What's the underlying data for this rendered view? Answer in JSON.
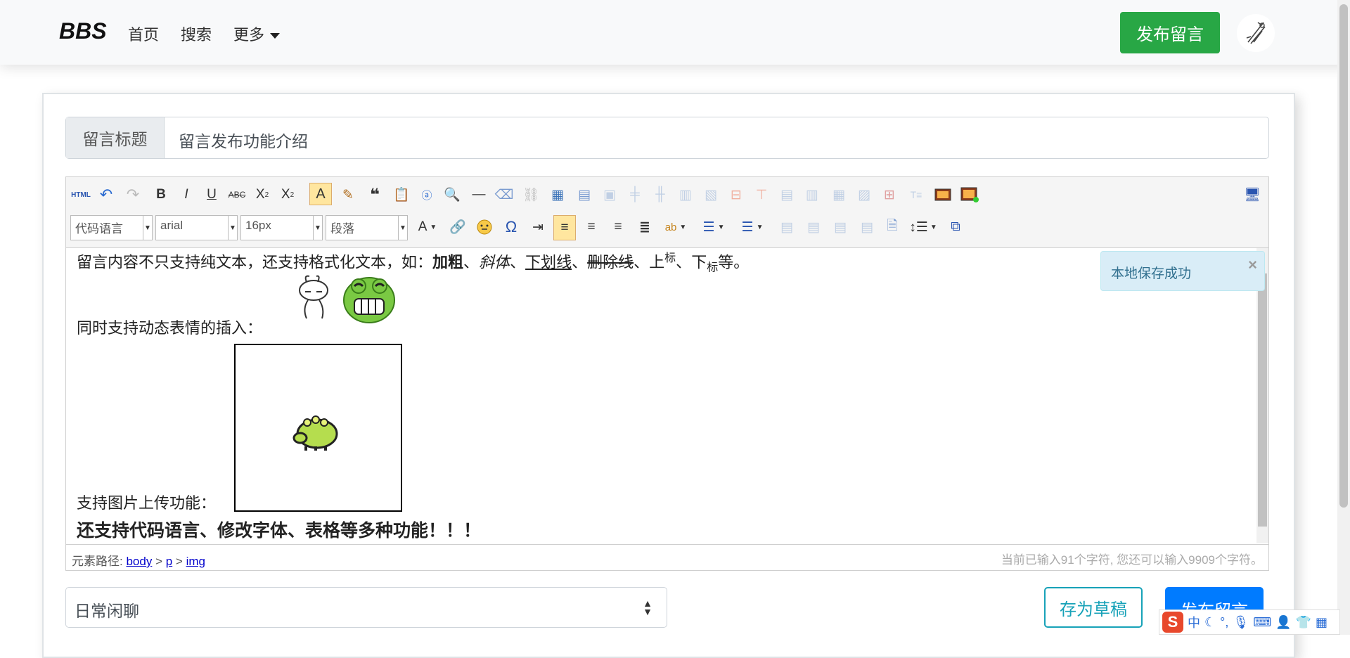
{
  "navbar": {
    "brand": "BBS",
    "links": [
      "首页",
      "搜索",
      "更多"
    ],
    "publish_button": "发布留言"
  },
  "form": {
    "title_label": "留言标题",
    "title_value": "留言发布功能介绍"
  },
  "toolbar": {
    "row1_icons": [
      "html-source-icon",
      "undo-icon",
      "redo-icon",
      "bold-icon",
      "italic-icon",
      "underline-icon",
      "strikethrough-icon",
      "subscript-icon",
      "superscript-icon",
      "font-border-icon",
      "format-brush-icon",
      "blockquote-icon",
      "paste-plain-icon",
      "select-all-icon",
      "search-replace-icon",
      "horizontal-rule-icon",
      "eraser-icon",
      "unlink-icon",
      "insert-table-icon",
      "delete-table-icon",
      "merge-cells-icon",
      "insert-row-icon",
      "insert-column-icon",
      "merge-right-icon",
      "merge-down-icon",
      "delete-row-icon",
      "delete-column-icon",
      "split-cells-icon",
      "split-rows-icon",
      "split-columns-icon",
      "table-props-icon",
      "insert-title-icon",
      "insert-image-icon",
      "image-gallery-icon"
    ],
    "selects": {
      "code_language": "代码语言",
      "font_family": "arial",
      "font_size": "16px",
      "paragraph": "段落"
    },
    "fullscreen_icon": "fullscreen-icon"
  },
  "content": {
    "line1_prefix": "留言内容不只支持纯文本，还支持格式化文本，如：",
    "bold": "加粗",
    "sep": "、",
    "italic": "斜体",
    "underline": "下划线",
    "strike": "删除线",
    "sup_prefix": "上",
    "sup": "标",
    "sub_prefix": "下",
    "sub": "标",
    "line1_suffix": "等。",
    "line2": "同时支持动态表情的插入：",
    "line3": "支持图片上传功能：",
    "line4": "还支持代码语言、修改字体、表格等多种功能！！！"
  },
  "statusbar": {
    "path_label": "元素路径:",
    "path": [
      "body",
      "p",
      "img"
    ],
    "count_text": "当前已输入91个字符, 您还可以输入9909个字符。"
  },
  "toast": {
    "message": "本地保存成功",
    "close": "×"
  },
  "footer": {
    "category": "日常闲聊",
    "draft_button": "存为草稿",
    "publish_button": "发布留言"
  },
  "ime": {
    "logo": "S",
    "mode": "中"
  }
}
